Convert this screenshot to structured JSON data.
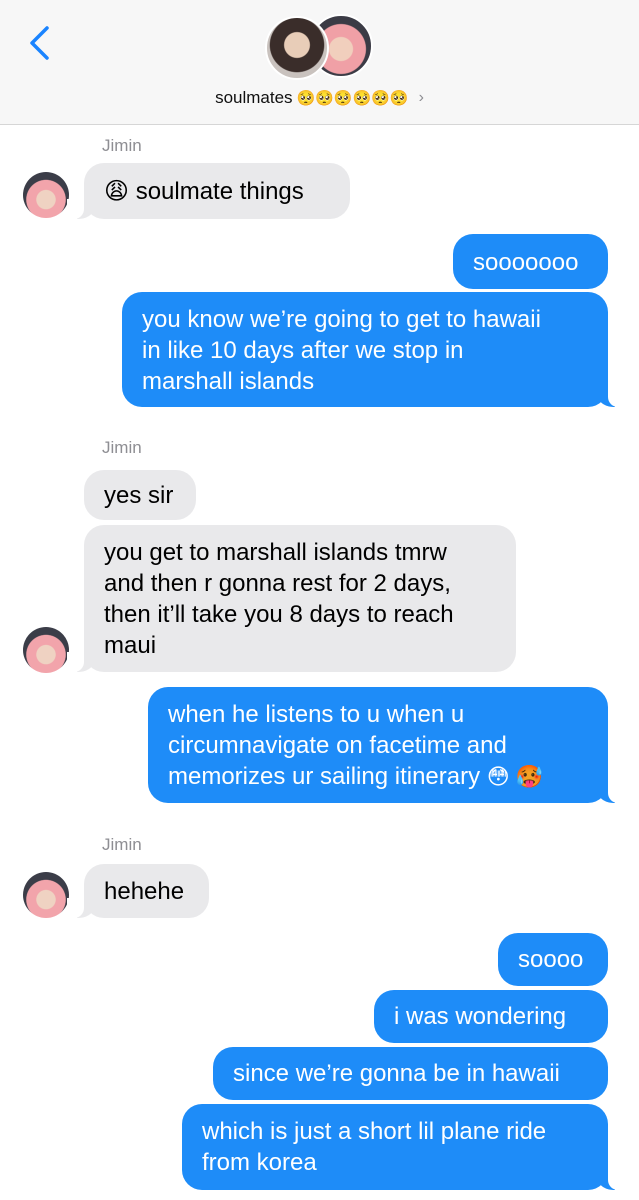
{
  "header": {
    "group_name": "soulmates",
    "group_emoji": "🥺🥺🥺🥺🥺🥺",
    "chevron": "›",
    "back_icon": "chevron-left-icon",
    "accent": "#1a84ff"
  },
  "colors": {
    "outgoing": "#1e8cf8",
    "incoming": "#e9e9eb",
    "sender_label": "#8e8e93"
  },
  "messages": [
    {
      "sender": "Jimin",
      "text": "😩 soulmate things"
    },
    {
      "text": "sooooooo"
    },
    {
      "lines": [
        "you know we’re going to get to hawaii",
        "in like 10 days after we stop in",
        "marshall islands"
      ]
    },
    {
      "sender": "Jimin",
      "text": "yes sir"
    },
    {
      "lines": [
        "you get to marshall islands tmrw",
        "and then r gonna rest for 2 days,",
        "then it’ll take you 8 days to reach",
        "maui"
      ]
    },
    {
      "lines": [
        "when he listens to u when u",
        "circumnavigate on facetime and",
        "memorizes ur sailing itinerary"
      ],
      "emoji": "😳 🥵"
    },
    {
      "sender": "Jimin",
      "text": "hehehe"
    },
    {
      "text": "soooo"
    },
    {
      "text": "i was wondering"
    },
    {
      "text": "since we’re gonna be in hawaii"
    },
    {
      "lines": [
        "which is just a short lil plane ride",
        "from korea"
      ]
    }
  ]
}
